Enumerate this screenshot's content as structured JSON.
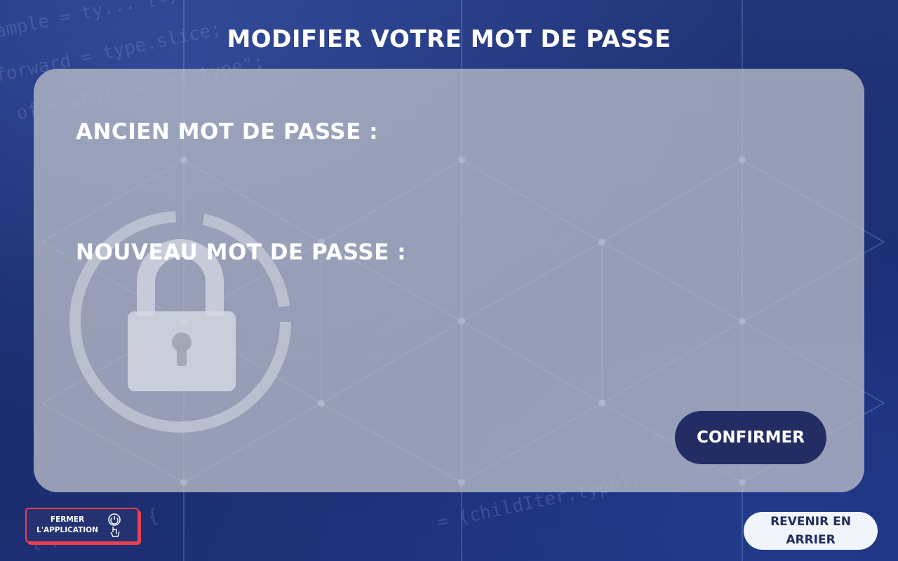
{
  "page": {
    "title": "MODIFIER VOTRE MOT DE PASSE"
  },
  "form": {
    "old_password_label": "ANCIEN MOT DE PASSE :",
    "new_password_label": "NOUVEAU MOT DE PASSE :",
    "confirm_label": "CONFIRMER"
  },
  "footer": {
    "close_app_label_line1": "FERMER",
    "close_app_label_line2": "L'APPLICATION",
    "back_label": "REVENIR EN ARRIER"
  },
  "colors": {
    "background": "#1b2a66",
    "card": "#b8bcc8",
    "confirm_button": "#232d63",
    "close_button_border": "#e94050",
    "back_button": "#f1f5fb"
  },
  "icons": {
    "lock": "lock-icon",
    "power": "power-touch-icon"
  }
}
